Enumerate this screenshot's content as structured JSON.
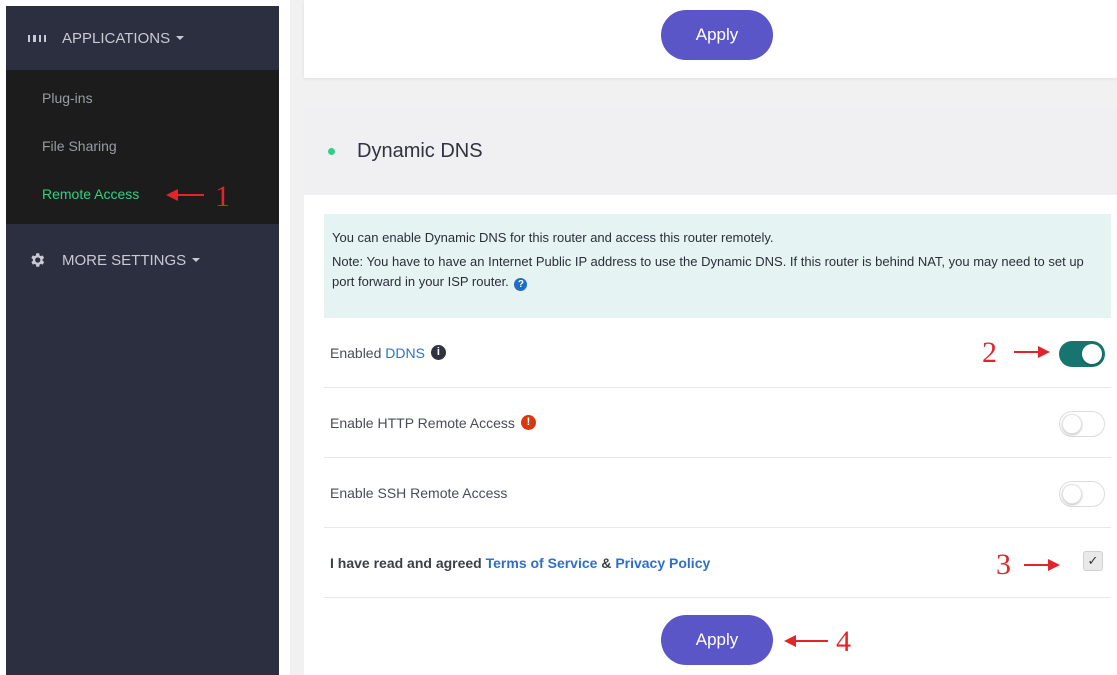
{
  "sidebar": {
    "applications_label": "APPLICATIONS",
    "items": [
      {
        "label": "Plug-ins"
      },
      {
        "label": "File Sharing"
      },
      {
        "label": "Remote Access"
      }
    ],
    "more_settings_label": "MORE SETTINGS"
  },
  "top_card": {
    "apply_label": "Apply"
  },
  "ddns": {
    "title": "Dynamic DNS",
    "info_line1": "You can enable Dynamic DNS for this router and access this router remotely.",
    "info_line2": "Note: You have to have an Internet Public IP address to use the Dynamic DNS. If this router is behind NAT, you may need to set up port forward in your ISP router.",
    "rows": {
      "enable_ddns_prefix": "Enabled ",
      "enable_ddns_link": "DDNS",
      "enable_ddns_state": true,
      "http_label": "Enable HTTP Remote Access",
      "http_state": false,
      "ssh_label": "Enable SSH Remote Access",
      "ssh_state": false,
      "agree_prefix": "I have read and agreed ",
      "terms_link": "Terms of Service",
      "amp": " & ",
      "privacy_link": "Privacy Policy",
      "agree_checked": true,
      "check_mark": "✓"
    },
    "apply_label": "Apply"
  },
  "annotations": [
    "1",
    "2",
    "3",
    "4"
  ],
  "colors": {
    "sidebar_bg": "#2c2f3f",
    "submenu_bg": "#1c1c1c",
    "active_green": "#2fd180",
    "apply_purple": "#5b56c8",
    "toggle_teal": "#17756f",
    "link_blue": "#2f6fc9",
    "annotation_red": "#e0262a"
  },
  "icons": {
    "applications": "grid-icon",
    "more_settings": "gear-icon",
    "ddns_info": "info-icon",
    "http_warning": "warning-icon",
    "note_help": "question-icon"
  }
}
